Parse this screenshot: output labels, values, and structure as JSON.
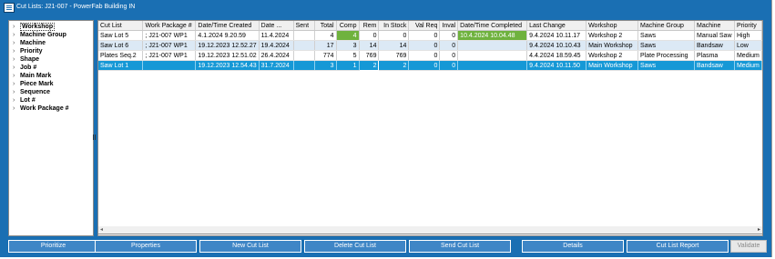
{
  "window": {
    "title": "Cut Lists: J21-007 - PowerFab Building IN"
  },
  "tree": {
    "items": [
      "Workshop",
      "Machine Group",
      "Machine",
      "Priority",
      "Shape",
      "Job #",
      "Main Mark",
      "Piece Mark",
      "Sequence",
      "Lot #",
      "Work Package #"
    ],
    "selected": "Workshop"
  },
  "grid": {
    "columns": [
      "Cut List",
      "Work Package #",
      "Date/Time Created",
      "Date ...",
      "Sent",
      "Total",
      "Comp",
      "Rem",
      "In Stock",
      "Val Req",
      "Inval",
      "Date/Time Completed",
      "Last Change",
      "Workshop",
      "Machine Group",
      "Machine",
      "Priority"
    ],
    "rows": [
      [
        "Saw Lot 5",
        "; J21-007 WP1",
        "4.1.2024 9.20.59",
        "11.4.2024",
        "",
        "4",
        "4",
        "0",
        "0",
        "0",
        "0",
        "10.4.2024 10.04.48",
        "9.4.2024 10.11.17",
        "Workshop 2",
        "Saws",
        "Manual Saw",
        "High"
      ],
      [
        "Saw Lot 6",
        "; J21-007 WP1",
        "19.12.2023 12.52.27",
        "19.4.2024",
        "",
        "17",
        "3",
        "14",
        "14",
        "0",
        "0",
        "",
        "9.4.2024 10.10.43",
        "Main Workshop",
        "Saws",
        "Bandsaw",
        "Low"
      ],
      [
        "Plates Seq.2",
        "; J21-007 WP1",
        "19.12.2023 12.51.02",
        "26.4.2024",
        "",
        "774",
        "5",
        "769",
        "769",
        "0",
        "0",
        "",
        "4.4.2024 18.59.45",
        "Workshop 2",
        "Plate Processing",
        "Plasma",
        "Medium"
      ],
      [
        "Saw Lot 1",
        "",
        "19.12.2023 12.54.43",
        "31.7.2024",
        "",
        "3",
        "1",
        "2",
        "2",
        "0",
        "0",
        "",
        "9.4.2024 10.11.50",
        "Main Workshop",
        "Saws",
        "Bandsaw",
        "Medium"
      ]
    ]
  },
  "buttons": {
    "prioritize": "Prioritize",
    "properties": "Properties",
    "new_cut_list": "New Cut List",
    "delete_cut_list": "Delete Cut List",
    "send_cut_list": "Send Cut List",
    "details": "Details",
    "cut_list_report": "Cut List Report",
    "validate": "Validate"
  },
  "colors": {
    "accent": "#1a6fb3",
    "selected_row": "#1598d6",
    "completed_green": "#6fb23e",
    "alt_row": "#dce9f5"
  }
}
